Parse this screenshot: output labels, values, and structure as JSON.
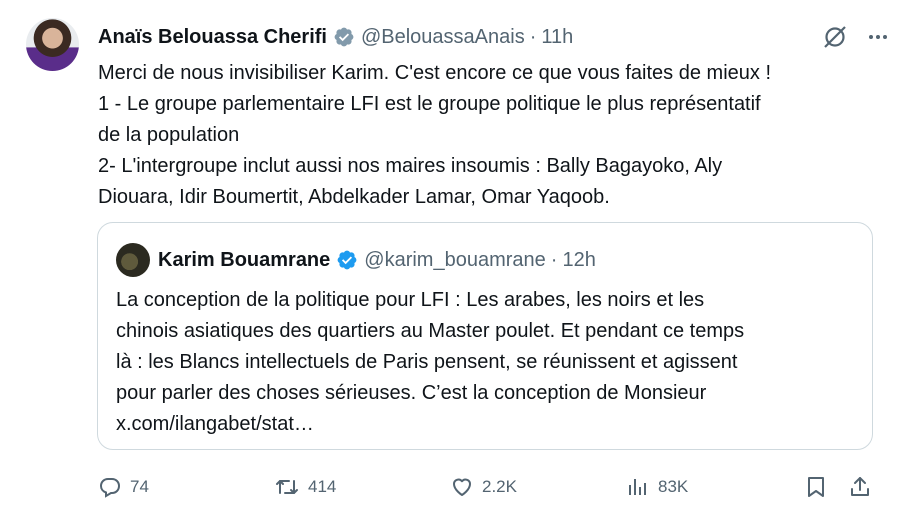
{
  "tweet": {
    "author": {
      "display_name": "Anaïs Belouassa Cherifi",
      "handle": "@BelouassaAnais",
      "time": "11h",
      "separator": "·"
    },
    "lines": [
      "Merci de nous invisibiliser Karim. C'est encore ce que vous faites de mieux !",
      "1 - Le groupe parlementaire LFI est le groupe politique le plus représentatif",
      "de la population",
      "2- L'intergroupe inclut aussi nos maires insoumis : Bally Bagayoko, Aly",
      "Diouara, Idir Boumertit, Abdelkader Lamar, Omar Yaqoob."
    ],
    "quote": {
      "display_name": "Karim Bouamrane",
      "handle": "@karim_bouamrane",
      "time": "12h",
      "separator": "·",
      "lines": [
        "La conception de la politique pour LFI : Les arabes, les noirs et les",
        "chinois asiatiques des quartiers au Master poulet. Et pendant ce temps",
        "là : les Blancs intellectuels de Paris pensent, se réunissent et agissent",
        "pour parler des choses sérieuses. C’est la conception de Monsieur",
        "x.com/ilangabet/stat…"
      ]
    },
    "actions": {
      "replies": "74",
      "reposts": "414",
      "likes": "2.2K",
      "views": "83K"
    },
    "icons": {
      "verified": "verified-badge-icon",
      "grok": "grok-icon",
      "more": "more-icon",
      "reply": "reply-icon",
      "repost": "repost-icon",
      "like": "like-icon",
      "views": "views-icon",
      "bookmark": "bookmark-icon",
      "share": "share-icon"
    },
    "colors": {
      "verified_blue": "#1d9bf0",
      "verified_gray": "#829aab",
      "secondary_text": "#536471"
    }
  }
}
